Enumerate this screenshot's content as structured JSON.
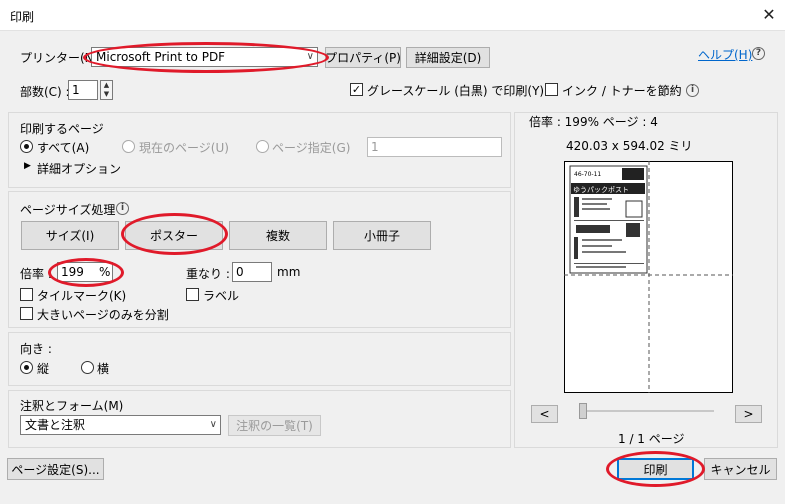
{
  "window": {
    "title": "印刷",
    "close": "✕"
  },
  "printer": {
    "label": "プリンター(N)",
    "value": "Microsoft Print to PDF",
    "properties": "プロパティ(P)",
    "advanced": "詳細設定(D)"
  },
  "help": {
    "label": "ヘルプ(H)",
    "icon": "?"
  },
  "copies": {
    "label": "部数(C) :",
    "value": "1"
  },
  "options": {
    "grayscale": "グレースケール (白黒) で印刷(Y)",
    "grayscale_checked": true,
    "ink_save": "インク / トナーを節約",
    "ink_save_checked": false
  },
  "pages": {
    "heading": "印刷するページ",
    "all": "すべて(A)",
    "current": "現在のページ(U)",
    "specify": "ページ指定(G)",
    "range_value": "1",
    "more_options": "詳細オプション"
  },
  "sizing": {
    "heading": "ページサイズ処理",
    "tabs": [
      "サイズ(I)",
      "ポスター",
      "複数",
      "小冊子"
    ],
    "scale_label": "倍率 :",
    "scale_value": "199",
    "scale_unit": "%",
    "overlap_label": "重なり :",
    "overlap_value": "0",
    "overlap_unit": "mm",
    "tile_marks": "タイルマーク(K)",
    "labels": "ラベル",
    "split_large": "大きいページのみを分割"
  },
  "orientation": {
    "heading": "向き :",
    "portrait": "縦",
    "landscape": "横"
  },
  "comments": {
    "heading": "注釈とフォーム(M)",
    "value": "文書と注釈",
    "summary_button": "注釈の一覧(T)"
  },
  "preview": {
    "scale_text": "倍率 : 199% ページ : 4",
    "dimensions": "420.03 x 594.02 ミリ",
    "label_code": "46-70-11",
    "label_brand": "ゆうパックポスト",
    "page_count": "1 / 1 ページ",
    "prev": "<",
    "next": ">"
  },
  "footer": {
    "page_setup": "ページ設定(S)...",
    "print": "印刷",
    "cancel": "キャンセル"
  },
  "colors": {
    "accent": "#0078d7",
    "annotation": "#e01a2a"
  }
}
